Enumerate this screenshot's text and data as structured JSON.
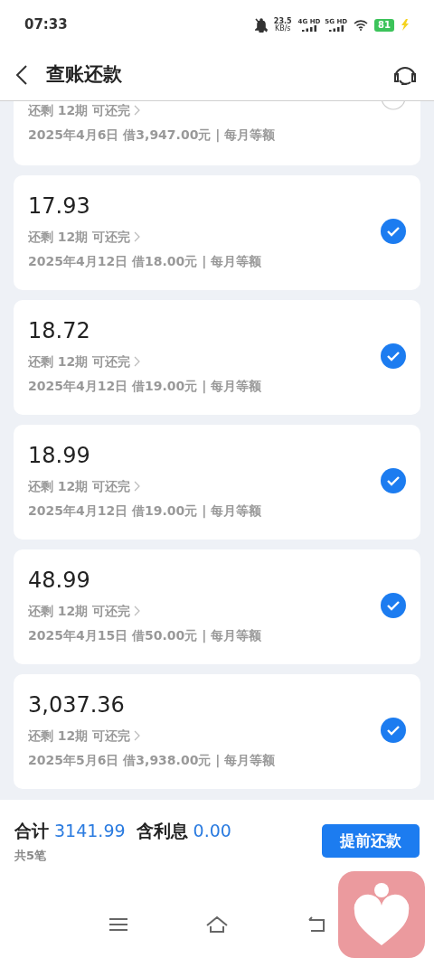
{
  "status_bar": {
    "time": "07:33",
    "net_speed": "23.5",
    "speed_unit": "KB/s",
    "sims": [
      "4G HD",
      "5G HD"
    ],
    "battery": "81"
  },
  "header": {
    "title": "查账还款"
  },
  "loans": [
    {
      "remaining": "还剩 12期 可还完",
      "detail": "2025年4月6日 借3,947.00元 | 每月等额",
      "selected": false
    },
    {
      "amount": "17.93",
      "remaining": "还剩 12期 可还完",
      "detail": "2025年4月12日 借18.00元 | 每月等额",
      "selected": true
    },
    {
      "amount": "18.72",
      "remaining": "还剩 12期 可还完",
      "detail": "2025年4月12日 借19.00元 | 每月等额",
      "selected": true
    },
    {
      "amount": "18.99",
      "remaining": "还剩 12期 可还完",
      "detail": "2025年4月12日 借19.00元 | 每月等额",
      "selected": true
    },
    {
      "amount": "48.99",
      "remaining": "还剩 12期 可还完",
      "detail": "2025年4月15日 借50.00元 | 每月等额",
      "selected": true
    },
    {
      "amount": "3,037.36",
      "remaining": "还剩 12期 可还完",
      "detail": "2025年5月6日 借3,938.00元 | 每月等额",
      "selected": true
    }
  ],
  "summary": {
    "total_label": "合计",
    "total": "3141.99",
    "interest_label": "含利息",
    "interest": "0.00",
    "count": "共5笔",
    "button": "提前还款"
  }
}
